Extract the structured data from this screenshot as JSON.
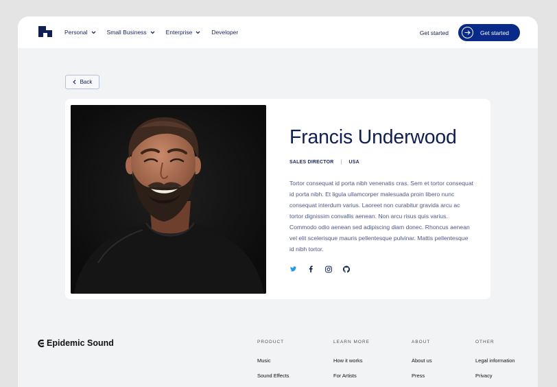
{
  "nav": {
    "items": [
      {
        "label": "Personal",
        "dropdown": true
      },
      {
        "label": "Small Business",
        "dropdown": true
      },
      {
        "label": "Enterprise",
        "dropdown": true
      },
      {
        "label": "Developer",
        "dropdown": false
      }
    ],
    "get_started_link": "Get started",
    "get_started_button": "Get started"
  },
  "back_label": "Back",
  "profile": {
    "name": "Francis Underwood",
    "role": "SALES DIRECTOR",
    "location": "USA",
    "bio": "Tortor consequat id porta nibh venenatis cras. Sem et tortor consequat id porta nibh. Et ligula ullamcorper malesuada proin libero nunc consequat interdum varius. Laoreet non curabitur gravida arcu ac tortor dignissim convallis aenean. Non arcu risus quis varius. Commodo odio aenean sed adipiscing diam donec. Rhoncus aenean vel elit scelerisque mauris pellentesque pulvinar. Mattis pellentesque id nibh tortor.",
    "socials": [
      "twitter-icon",
      "facebook-icon",
      "instagram-icon",
      "github-icon"
    ]
  },
  "footer": {
    "brand": "Epidemic Sound",
    "columns": [
      {
        "heading": "PRODUCT",
        "links": [
          "Music",
          "Sound Effects"
        ]
      },
      {
        "heading": "LEARN MORE",
        "links": [
          "How it works",
          "For Artists"
        ]
      },
      {
        "heading": "ABOUT",
        "links": [
          "About us",
          "Press"
        ]
      },
      {
        "heading": "OTHER",
        "links": [
          "Legal information",
          "Privacy"
        ]
      }
    ]
  },
  "colors": {
    "navy": "#0f1f55",
    "button": "#0a2a8a",
    "twitter": "#1d9bf0",
    "page_bg": "#f2f3f5"
  }
}
